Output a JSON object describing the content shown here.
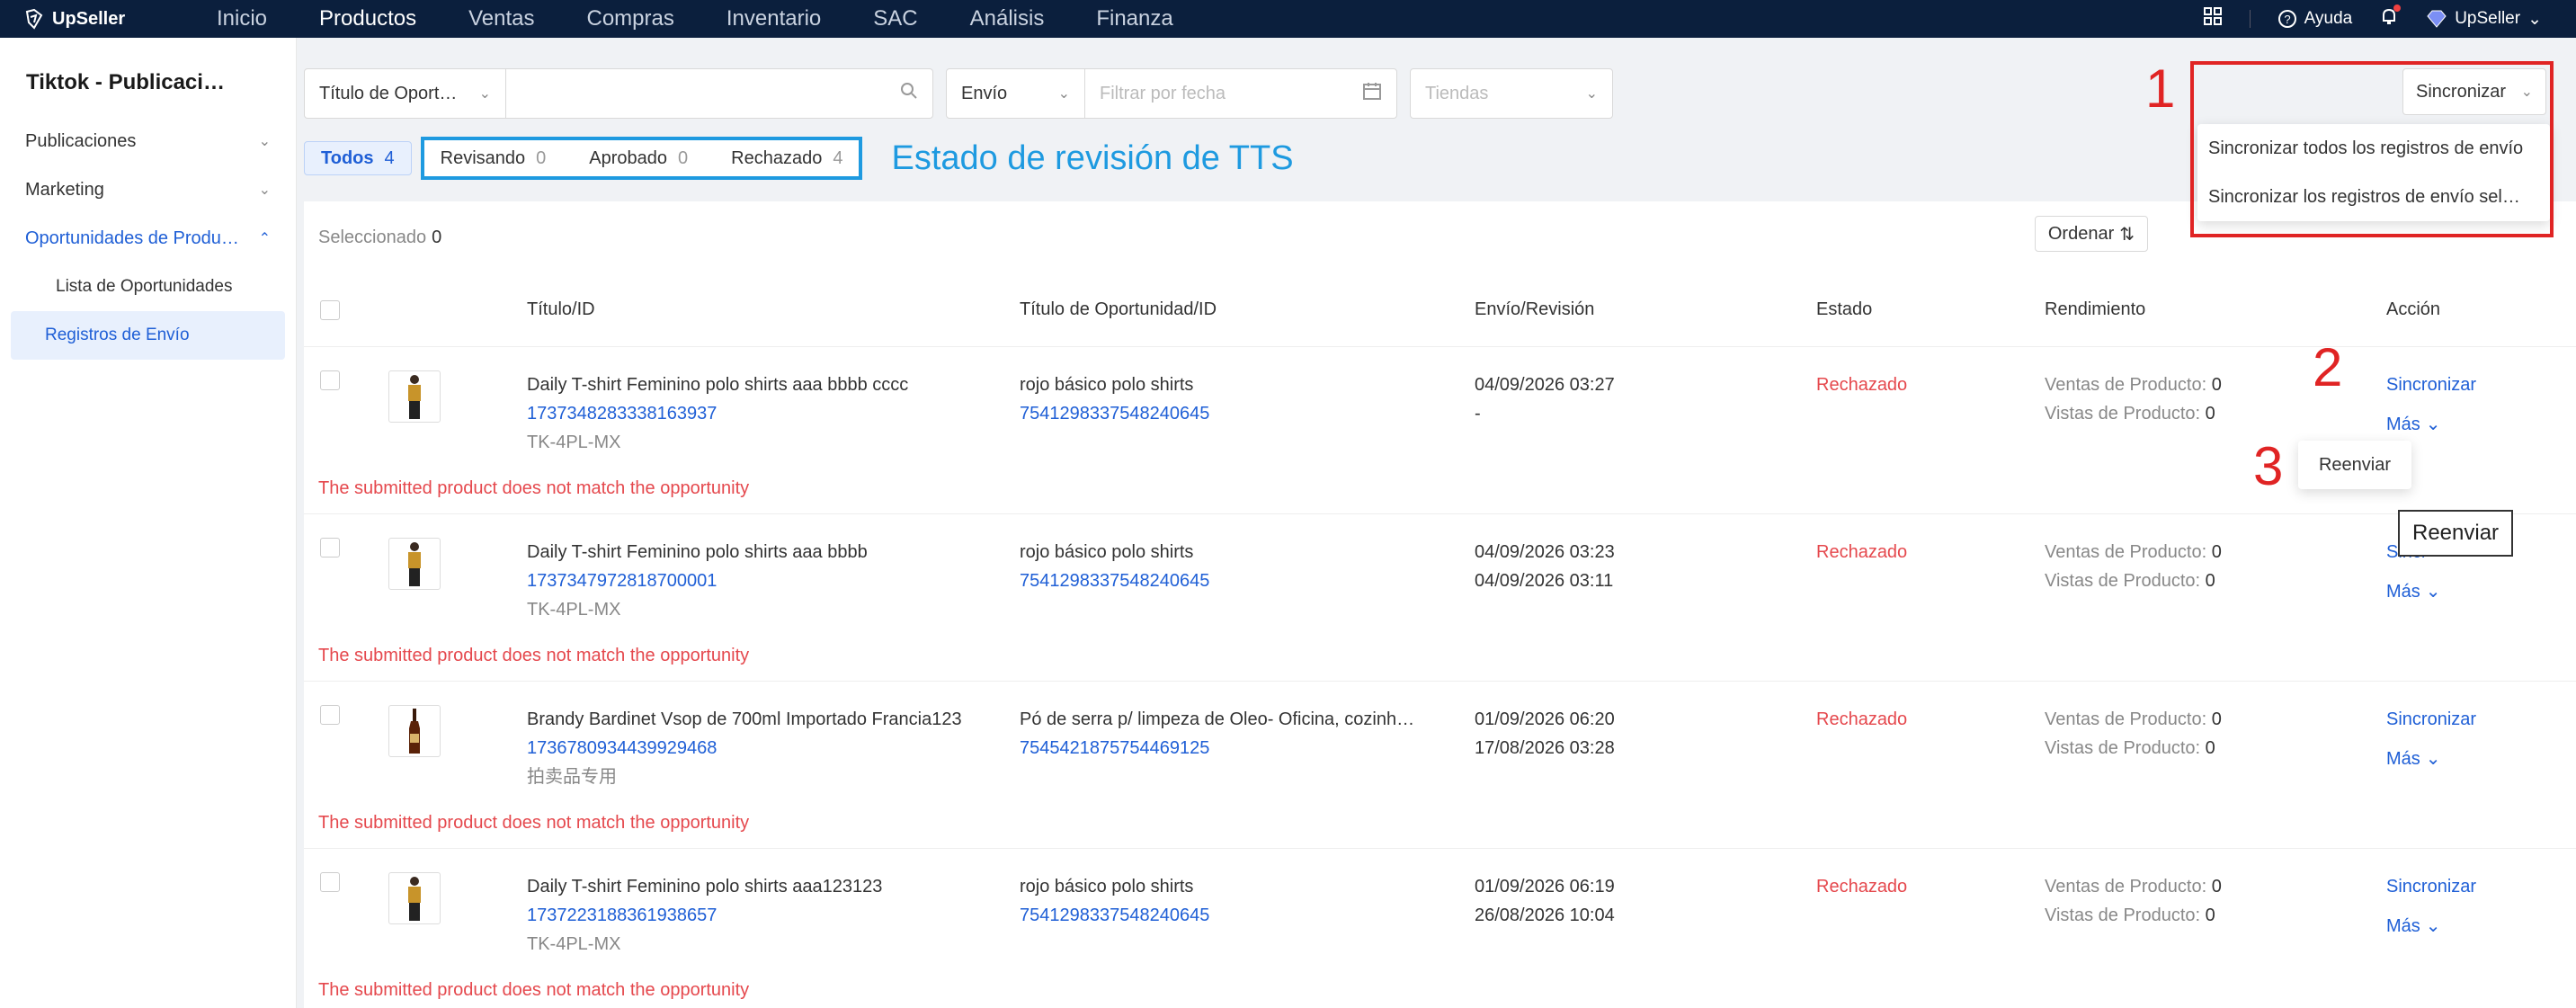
{
  "brand": "UpSeller",
  "nav": [
    "Inicio",
    "Productos",
    "Ventas",
    "Compras",
    "Inventario",
    "SAC",
    "Análisis",
    "Finanza"
  ],
  "nav_right": {
    "help": "Ayuda",
    "user": "UpSeller"
  },
  "sidebar": {
    "title": "Tiktok - Publicaci…",
    "items": [
      "Publicaciones",
      "Marketing",
      "Oportunidades de Produ…"
    ],
    "subitems": [
      "Lista de Oportunidades",
      "Registros de Envío"
    ]
  },
  "filters": {
    "title_select": "Título de Oport…",
    "ship_select": "Envío",
    "date_placeholder": "Filtrar por fecha",
    "stores_placeholder": "Tiendas"
  },
  "tabs": {
    "todos": "Todos",
    "todos_n": "4",
    "revisando": "Revisando",
    "revisando_n": "0",
    "aprobado": "Aprobado",
    "aprobado_n": "0",
    "rechazado": "Rechazado",
    "rechazado_n": "4"
  },
  "tts_label": "Estado de revisión de TTS",
  "sync": {
    "button": "Sincronizar",
    "opt1": "Sincronizar todos los registros de envío",
    "opt2": "Sincronizar los registros de envío sel…"
  },
  "selected_label": "Seleccionado",
  "selected_n": "0",
  "ordenar": "Ordenar",
  "columns": [
    "Título/ID",
    "Título de Oportunidad/ID",
    "Envío/Revisión",
    "Estado",
    "Rendimiento",
    "Acción"
  ],
  "rows": [
    {
      "title": "Daily T-shirt Feminino polo shirts aaa bbbb cccc",
      "id": "1737348283338163937",
      "sku": "TK-4PL-MX",
      "opp": "rojo básico polo shirts",
      "opp_id": "7541298337548240645",
      "d1": "04/09/2026 03:27",
      "d2": "-",
      "status": "Rechazado",
      "ventas": "Ventas de Producto:",
      "ventas_n": "0",
      "vistas": "Vistas de Producto:",
      "vistas_n": "0",
      "error": "The submitted product does not match the opportunity"
    },
    {
      "title": "Daily T-shirt Feminino polo shirts aaa bbbb",
      "id": "1737347972818700001",
      "sku": "TK-4PL-MX",
      "opp": "rojo básico polo shirts",
      "opp_id": "7541298337548240645",
      "d1": "04/09/2026 03:23",
      "d2": "04/09/2026 03:11",
      "status": "Rechazado",
      "ventas": "Ventas de Producto:",
      "ventas_n": "0",
      "vistas": "Vistas de Producto:",
      "vistas_n": "0",
      "error": "The submitted product does not match the opportunity"
    },
    {
      "title": "Brandy Bardinet Vsop de 700ml Importado Francia123",
      "id": "1736780934439929468",
      "sku": "拍卖品专用",
      "opp": "Pó de serra p/ limpeza de Oleo- Oficina, cozinh…",
      "opp_id": "7545421875754469125",
      "d1": "01/09/2026 06:20",
      "d2": "17/08/2026 03:28",
      "status": "Rechazado",
      "ventas": "Ventas de Producto:",
      "ventas_n": "0",
      "vistas": "Vistas de Producto:",
      "vistas_n": "0",
      "error": "The submitted product does not match the opportunity"
    },
    {
      "title": "Daily T-shirt Feminino polo shirts aaa123123",
      "id": "1737223188361938657",
      "sku": "TK-4PL-MX",
      "opp": "rojo básico polo shirts",
      "opp_id": "7541298337548240645",
      "d1": "01/09/2026 06:19",
      "d2": "26/08/2026 10:04",
      "status": "Rechazado",
      "ventas": "Ventas de Producto:",
      "ventas_n": "0",
      "vistas": "Vistas de Producto:",
      "vistas_n": "0",
      "error": "The submitted product does not match the opportunity"
    }
  ],
  "action": {
    "sync": "Sincronizar",
    "more": "Más",
    "resend": "Reenviar",
    "sync_partial": "Sincr"
  },
  "tooltip": "Reenviar",
  "annotations": [
    "1",
    "2",
    "3"
  ]
}
